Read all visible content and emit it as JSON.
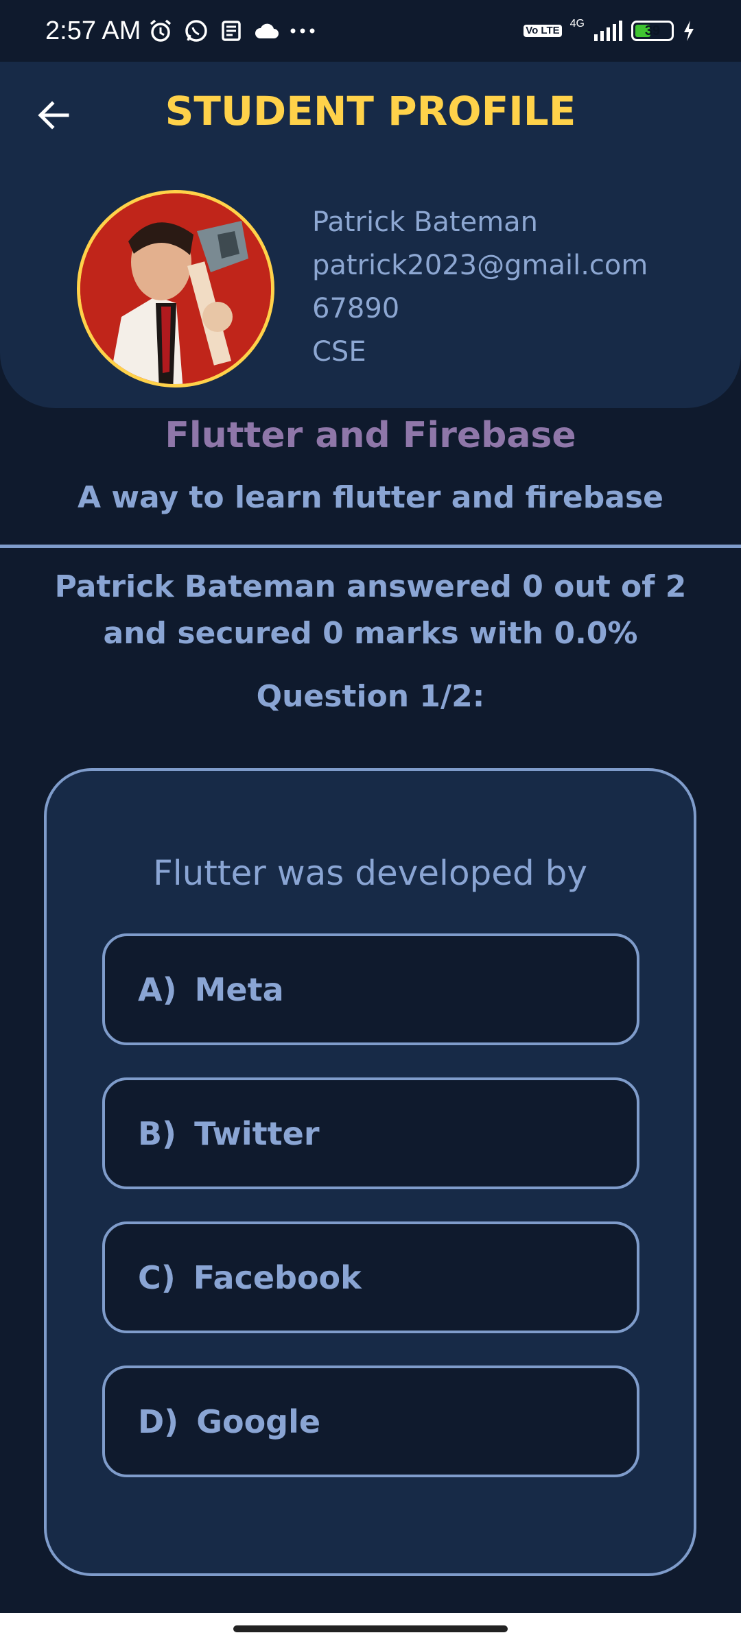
{
  "status_bar": {
    "time": "2:57 AM",
    "network": "4G",
    "volte": "Vo LTE",
    "battery": "39",
    "battery_level": 0.39,
    "icons": [
      "alarm-icon",
      "whatsapp-icon",
      "news-icon",
      "cloud-icon",
      "more-dots-icon",
      "signal-icon",
      "charging-icon"
    ]
  },
  "header": {
    "title": "STUDENT PROFILE",
    "back_icon": "arrow-left-icon"
  },
  "profile": {
    "name": "Patrick Bateman",
    "email": "patrick2023@gmail.com",
    "id": "67890",
    "department": "CSE"
  },
  "course": {
    "title": "Flutter and Firebase",
    "subtitle": "A way to learn flutter and firebase"
  },
  "result": {
    "text": "Patrick Bateman answered 0 out of 2 and secured 0 marks with 0.0%"
  },
  "quiz": {
    "counter": "Question 1/2:",
    "question": "Flutter was developed by",
    "options": [
      {
        "letter": "A)",
        "text": "Meta"
      },
      {
        "letter": "B)",
        "text": "Twitter"
      },
      {
        "letter": "C)",
        "text": "Facebook"
      },
      {
        "letter": "D)",
        "text": "Google"
      }
    ]
  },
  "colors": {
    "background": "#0f1a2d",
    "card": "#172a47",
    "accent": "#ffd24a",
    "text": "#8aa5d4",
    "course_title": "#8f77a9"
  }
}
